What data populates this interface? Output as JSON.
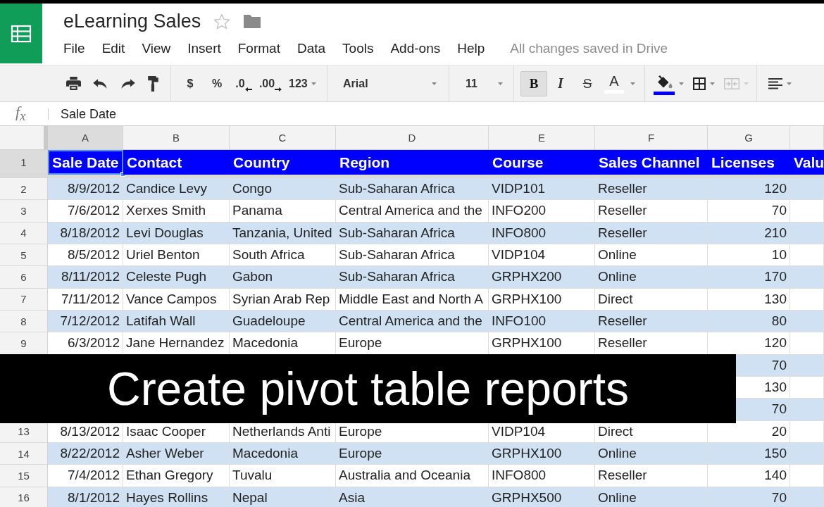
{
  "app": {
    "title": "eLearning Sales",
    "starred": false
  },
  "menu": {
    "items": [
      "File",
      "Edit",
      "View",
      "Insert",
      "Format",
      "Data",
      "Tools",
      "Add-ons",
      "Help"
    ],
    "save_status": "All changes saved in Drive"
  },
  "toolbar": {
    "currency": "$",
    "percent": "%",
    "decrease_decimal": ".0",
    "increase_decimal": ".00",
    "number_format": "123",
    "font": "Arial",
    "font_size": "11",
    "bold": {
      "label": "B",
      "on": true
    },
    "italic": {
      "label": "I",
      "on": false
    },
    "strikethrough": {
      "label": "S",
      "on": false
    },
    "text_color": {
      "label": "A",
      "color": "#ffffff"
    },
    "fill_color": {
      "color": "#0000ff"
    },
    "merge": {
      "disabled": true
    }
  },
  "formula_bar": {
    "label": "f$_{x}$",
    "value": "Sale Date"
  },
  "sheet": {
    "columns": [
      {
        "letter": "A",
        "selected": true
      },
      {
        "letter": "B",
        "selected": false
      },
      {
        "letter": "C",
        "selected": false
      },
      {
        "letter": "D",
        "selected": false
      },
      {
        "letter": "E",
        "selected": false
      },
      {
        "letter": "F",
        "selected": false
      },
      {
        "letter": "G",
        "selected": false
      }
    ],
    "header_row": {
      "number": "1",
      "selected": true,
      "cells": [
        "Sale Date",
        "Contact",
        "Country",
        "Region",
        "Course",
        "Sales Channel",
        "Licenses",
        "Valu"
      ]
    },
    "rows": [
      {
        "number": "2",
        "selected": false,
        "cells": [
          "8/9/2012",
          "Candice Levy",
          "Congo",
          "Sub-Saharan Africa",
          "VIDP101",
          "Reseller",
          "120"
        ]
      },
      {
        "number": "3",
        "selected": false,
        "cells": [
          "7/6/2012",
          "Xerxes Smith",
          "Panama",
          "Central America and the",
          "INFO200",
          "Reseller",
          "70"
        ]
      },
      {
        "number": "4",
        "selected": false,
        "cells": [
          "8/18/2012",
          "Levi Douglas",
          "Tanzania, United",
          "Sub-Saharan Africa",
          "INFO800",
          "Reseller",
          "210"
        ]
      },
      {
        "number": "5",
        "selected": false,
        "cells": [
          "8/5/2012",
          "Uriel Benton",
          "South Africa",
          "Sub-Saharan Africa",
          "VIDP104",
          "Online",
          "10"
        ]
      },
      {
        "number": "6",
        "selected": false,
        "cells": [
          "8/11/2012",
          "Celeste Pugh",
          "Gabon",
          "Sub-Saharan Africa",
          "GRPHX200",
          "Online",
          "170"
        ]
      },
      {
        "number": "7",
        "selected": false,
        "cells": [
          "7/11/2012",
          "Vance Campos",
          "Syrian Arab Rep",
          "Middle East and North A",
          "GRPHX100",
          "Direct",
          "130"
        ]
      },
      {
        "number": "8",
        "selected": false,
        "cells": [
          "7/12/2012",
          "Latifah Wall",
          "Guadeloupe",
          "Central America and the",
          "INFO100",
          "Reseller",
          "80"
        ]
      },
      {
        "number": "9",
        "selected": false,
        "cells": [
          "6/3/2012",
          "Jane Hernandez",
          "Macedonia",
          "Europe",
          "GRPHX100",
          "Reseller",
          "120"
        ]
      },
      {
        "cells": [
          null,
          null,
          null,
          null,
          null,
          null,
          "70"
        ]
      },
      {
        "cells": [
          null,
          null,
          null,
          null,
          null,
          null,
          "130"
        ]
      },
      {
        "cells": [
          null,
          null,
          null,
          null,
          null,
          null,
          "70"
        ]
      },
      {
        "number": "13",
        "selected": false,
        "cells": [
          "8/13/2012",
          "Isaac Cooper",
          "Netherlands Anti",
          "Europe",
          "VIDP104",
          "Direct",
          "20"
        ]
      },
      {
        "number": "14",
        "selected": false,
        "cells": [
          "8/22/2012",
          "Asher Weber",
          "Macedonia",
          "Europe",
          "GRPHX100",
          "Online",
          "150"
        ]
      },
      {
        "number": "15",
        "selected": false,
        "cells": [
          "7/4/2012",
          "Ethan Gregory",
          "Tuvalu",
          "Australia and Oceania",
          "INFO800",
          "Reseller",
          "140"
        ]
      },
      {
        "number": "16",
        "selected": false,
        "cells": [
          "8/1/2012",
          "Hayes Rollins",
          "Nepal",
          "Asia",
          "GRPHX500",
          "Online",
          "70"
        ]
      }
    ]
  },
  "caption": "Create pivot table reports"
}
